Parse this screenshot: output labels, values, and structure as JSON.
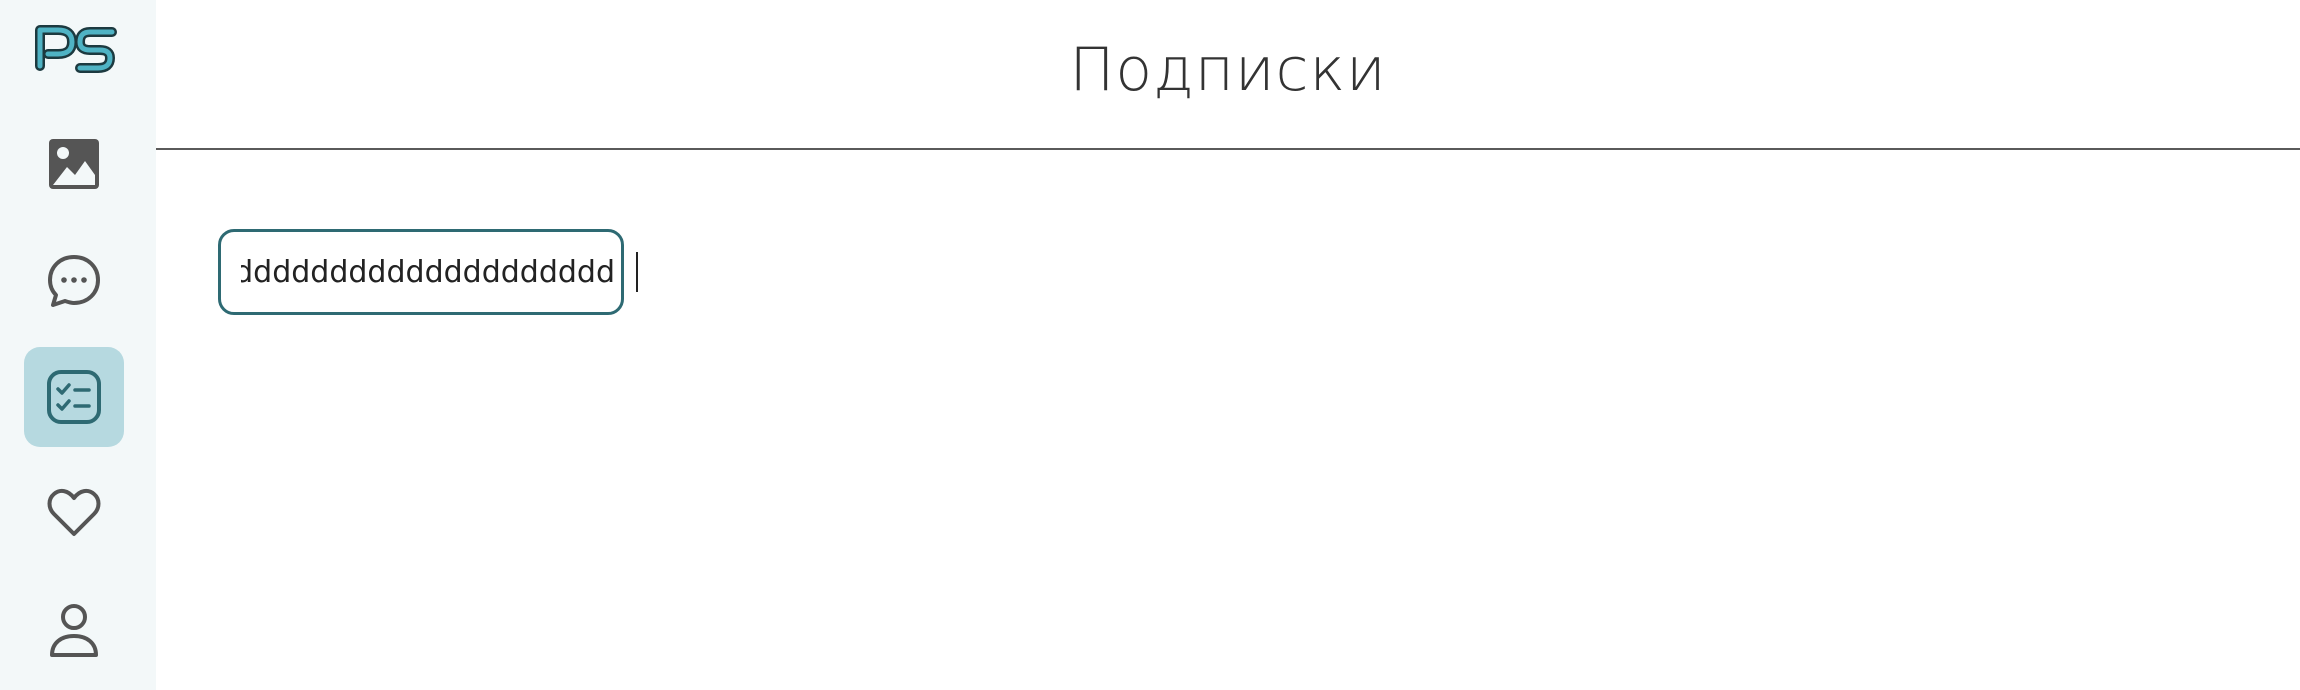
{
  "colors": {
    "sidebar_bg": "#f3f8f9",
    "active_item_bg": "#b6d9e0",
    "accent": "#2e6a73",
    "icon": "#555555"
  },
  "logo": {
    "text": "PS"
  },
  "sidebar": {
    "items": [
      {
        "icon": "image-icon",
        "active": false
      },
      {
        "icon": "chat-bubble-icon",
        "active": false
      },
      {
        "icon": "checklist-icon",
        "active": true
      },
      {
        "icon": "heart-icon",
        "active": false
      },
      {
        "icon": "user-icon",
        "active": false
      }
    ]
  },
  "header": {
    "title": "Подписки"
  },
  "search": {
    "value": "dddddddddddddddddddddd"
  }
}
